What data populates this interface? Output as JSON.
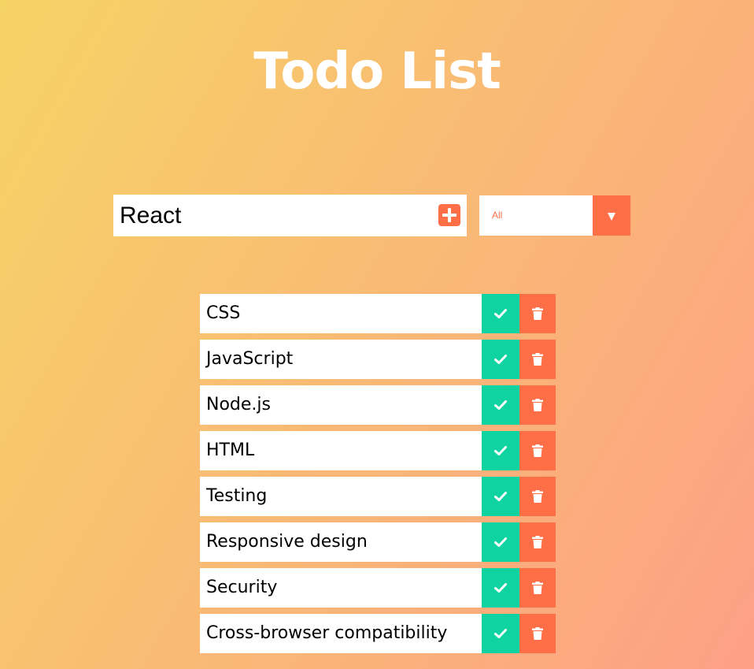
{
  "app": {
    "title": "Todo List"
  },
  "form": {
    "input_value": "React",
    "add_icon": "plus-square-icon",
    "filter_selected": "All"
  },
  "colors": {
    "accent": "#ff6f47",
    "complete": "#0fd3a0",
    "gradient_start": "#f6d365",
    "gradient_end": "#fda085"
  },
  "todos": [
    {
      "text": "CSS"
    },
    {
      "text": "JavaScript"
    },
    {
      "text": "Node.js"
    },
    {
      "text": "HTML"
    },
    {
      "text": "Testing"
    },
    {
      "text": "Responsive design"
    },
    {
      "text": "Security"
    },
    {
      "text": "Cross-browser compatibility"
    }
  ],
  "icons": {
    "complete": "check-icon",
    "delete": "trash-icon",
    "dropdown": "chevron-down-icon"
  }
}
